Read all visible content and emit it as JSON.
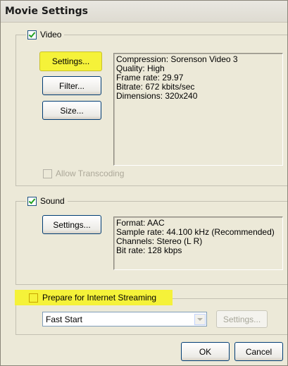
{
  "window": {
    "title": "Movie Settings"
  },
  "video": {
    "label": "Video",
    "checked": true,
    "settings_button": "Settings...",
    "filter_button": "Filter...",
    "size_button": "Size...",
    "info": [
      "Compression: Sorenson Video 3",
      "Quality: High",
      "Frame rate: 29.97",
      "Bitrate: 672 kbits/sec",
      "Dimensions: 320x240"
    ],
    "allow_transcoding": "Allow Transcoding"
  },
  "sound": {
    "label": "Sound",
    "checked": true,
    "settings_button": "Settings...",
    "info": [
      "Format: AAC",
      "Sample rate: 44.100 kHz (Recommended)",
      "Channels: Stereo (L R)",
      "Bit rate: 128 kbps"
    ]
  },
  "streaming": {
    "label": "Prepare for Internet Streaming",
    "checked": false,
    "mode_value": "Fast Start",
    "settings_button": "Settings..."
  },
  "footer": {
    "ok": "OK",
    "cancel": "Cancel"
  },
  "colors": {
    "highlight": "#f5f239",
    "background": "#ece9d8"
  }
}
